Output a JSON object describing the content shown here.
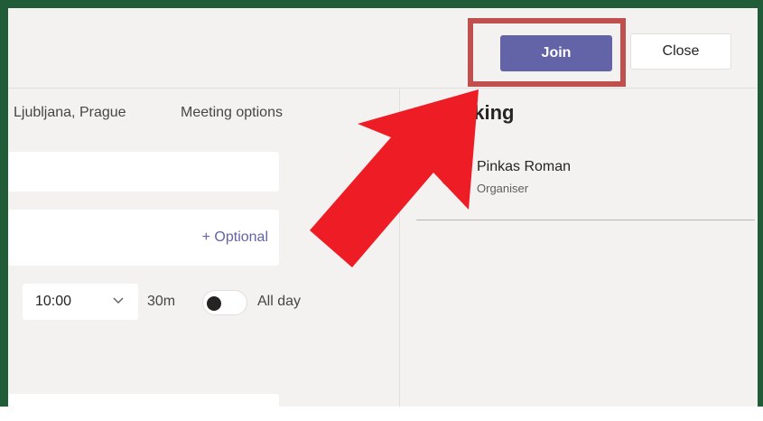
{
  "header": {
    "join_label": "Join",
    "close_label": "Close"
  },
  "left": {
    "timezone_text": "Ljubljana, Prague",
    "meeting_options": "Meeting options",
    "optional_label": "+ Optional",
    "time_value": "10:00",
    "duration": "30m",
    "allday_label": "All day"
  },
  "right": {
    "tracking_title": "Tracking",
    "participant": {
      "name": "Pinkas Roman",
      "role": "Organiser"
    }
  },
  "colors": {
    "join_bg": "#6264a7",
    "highlight": "#c0504d",
    "arrow": "#ee1c24",
    "frame": "#1f5c37"
  }
}
